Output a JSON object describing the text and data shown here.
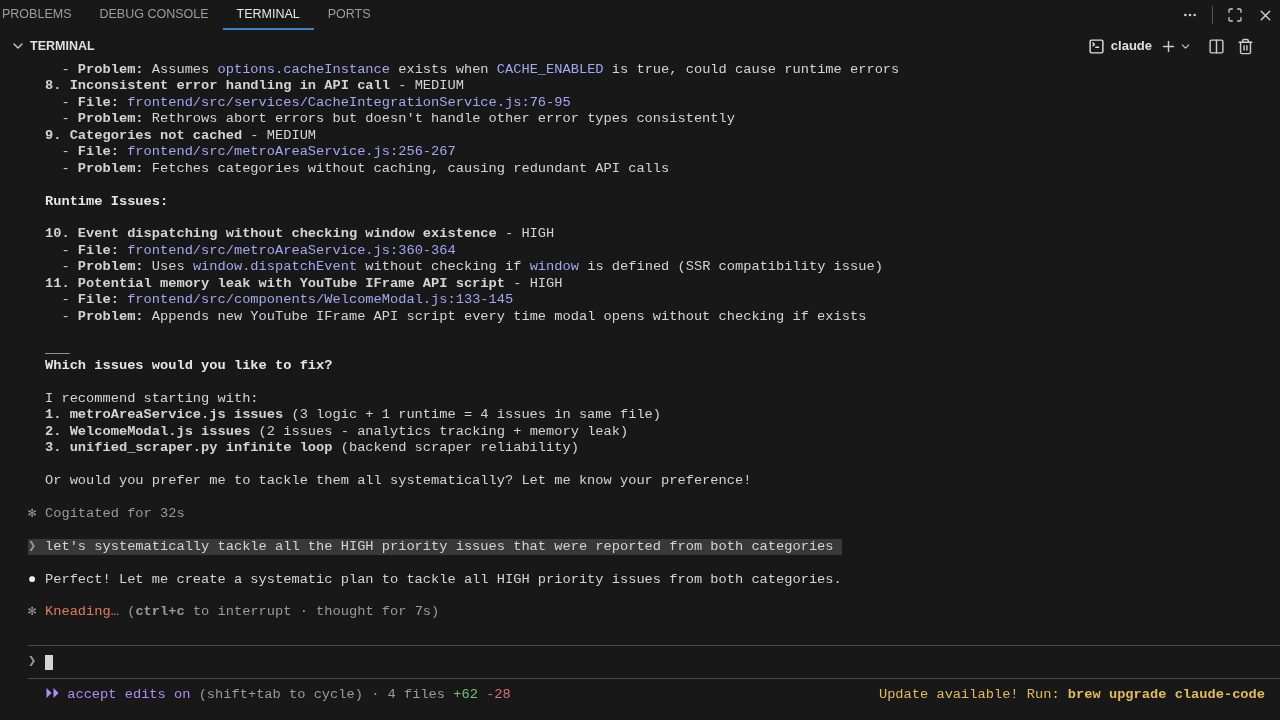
{
  "panel_tabs": [
    {
      "label": "PROBLEMS",
      "selected": false
    },
    {
      "label": "DEBUG CONSOLE",
      "selected": false
    },
    {
      "label": "TERMINAL",
      "selected": true
    },
    {
      "label": "PORTS",
      "selected": false
    }
  ],
  "section": {
    "title": "TERMINAL",
    "expanded": true,
    "shell_name": "claude"
  },
  "lines": [
    {
      "kind": "text",
      "segments": [
        {
          "kind": "text",
          "text": "  - **Problem:** Assumes "
        },
        {
          "kind": "code",
          "text": "options.cacheInstance"
        },
        {
          "kind": "text",
          "text": " exists when "
        },
        {
          "kind": "code",
          "text": "CACHE_ENABLED"
        },
        {
          "kind": "text",
          "text": " is true, could cause runtime errors"
        }
      ]
    },
    {
      "kind": "text",
      "segments": [
        {
          "kind": "text",
          "text": "**8. Inconsistent error handling in API call** - MEDIUM"
        }
      ]
    },
    {
      "kind": "text",
      "segments": [
        {
          "kind": "text",
          "text": "  - **File:** "
        },
        {
          "kind": "code",
          "text": "frontend/src/services/CacheIntegrationService.js:76-95"
        }
      ]
    },
    {
      "kind": "text",
      "segments": [
        {
          "kind": "text",
          "text": "  - **Problem:** Rethrows abort errors but doesn't handle other error types consistently"
        }
      ]
    },
    {
      "kind": "text",
      "segments": [
        {
          "kind": "text",
          "text": "**9. Categories not cached** - MEDIUM"
        }
      ]
    },
    {
      "kind": "text",
      "segments": [
        {
          "kind": "text",
          "text": "  - **File:** "
        },
        {
          "kind": "code",
          "text": "frontend/src/metroAreaService.js:256-267"
        }
      ]
    },
    {
      "kind": "text",
      "segments": [
        {
          "kind": "text",
          "text": "  - **Problem:** Fetches categories without caching, causing redundant API calls"
        }
      ]
    },
    {
      "kind": "blank"
    },
    {
      "kind": "text",
      "segments": [
        {
          "kind": "heading",
          "text": "Runtime Issues:"
        }
      ]
    },
    {
      "kind": "blank"
    },
    {
      "kind": "text",
      "segments": [
        {
          "kind": "text",
          "text": "**10. Event dispatching without checking window existence** - HIGH"
        }
      ]
    },
    {
      "kind": "text",
      "segments": [
        {
          "kind": "text",
          "text": "  - **File:** "
        },
        {
          "kind": "code",
          "text": "frontend/src/metroAreaService.js:360-364"
        }
      ]
    },
    {
      "kind": "text",
      "segments": [
        {
          "kind": "text",
          "text": "  - **Problem:** Uses "
        },
        {
          "kind": "code",
          "text": "window.dispatchEvent"
        },
        {
          "kind": "text",
          "text": " without checking if "
        },
        {
          "kind": "code",
          "text": "window"
        },
        {
          "kind": "text",
          "text": " is defined (SSR compatibility issue)"
        }
      ]
    },
    {
      "kind": "text",
      "segments": [
        {
          "kind": "text",
          "text": "**11. Potential memory leak with YouTube IFrame API script** - HIGH"
        }
      ]
    },
    {
      "kind": "text",
      "segments": [
        {
          "kind": "text",
          "text": "  - **File:** "
        },
        {
          "kind": "code",
          "text": "frontend/src/components/WelcomeModal.js:133-145"
        }
      ]
    },
    {
      "kind": "text",
      "segments": [
        {
          "kind": "text",
          "text": "  - **Problem:** Appends new YouTube IFrame API script every time modal opens without checking if exists"
        }
      ]
    },
    {
      "kind": "blank"
    },
    {
      "kind": "text",
      "segments": [
        {
          "kind": "text",
          "text": "___"
        }
      ]
    },
    {
      "kind": "text",
      "segments": [
        {
          "kind": "heading",
          "text": "Which issues would you like to fix?"
        }
      ]
    },
    {
      "kind": "blank"
    },
    {
      "kind": "text",
      "segments": [
        {
          "kind": "text",
          "text": "I recommend starting with:"
        }
      ]
    },
    {
      "kind": "text",
      "segments": [
        {
          "kind": "text",
          "text": "**1. metroAreaService.js issues** (3 logic + 1 runtime = 4 issues in same file)"
        }
      ]
    },
    {
      "kind": "text",
      "segments": [
        {
          "kind": "text",
          "text": "**2. WelcomeModal.js issues** (2 issues - analytics tracking + memory leak)"
        }
      ]
    },
    {
      "kind": "text",
      "segments": [
        {
          "kind": "text",
          "text": "**3. unified_scraper.py infinite loop** (backend scraper reliability)"
        }
      ]
    },
    {
      "kind": "blank"
    },
    {
      "kind": "text",
      "segments": [
        {
          "kind": "text",
          "text": "Or would you prefer me to tackle them all systematically? Let me know your preference!"
        }
      ]
    },
    {
      "kind": "blank"
    },
    {
      "kind": "status",
      "marker": "✻",
      "segments": [
        {
          "kind": "dim",
          "text": "Cogitated for 32s"
        }
      ]
    },
    {
      "kind": "blank"
    },
    {
      "kind": "prompt",
      "marker": "❯",
      "segments": [
        {
          "kind": "text",
          "text": "let's systematically tackle all the HIGH priority issues that were reported from both categories "
        }
      ]
    },
    {
      "kind": "blank"
    },
    {
      "kind": "bullet",
      "marker": "●",
      "segments": [
        {
          "kind": "text",
          "text": "Perfect! Let me create a systematic plan to tackle all HIGH priority issues from both categories."
        }
      ]
    },
    {
      "kind": "blank"
    },
    {
      "kind": "status",
      "marker": "✻",
      "segments": [
        {
          "kind": "accent",
          "text": "Kneading…"
        },
        {
          "kind": "dim",
          "text": " (**ctrl+c** to interrupt · thought for 7s)"
        }
      ]
    },
    {
      "kind": "blank"
    }
  ],
  "input": {
    "marker": "❯"
  },
  "footer": {
    "left": [
      {
        "kind": "mode",
        "text": "⏵⏵ accept edits on"
      },
      {
        "kind": "dim",
        "text": " (shift+tab to cycle) · 4 files "
      },
      {
        "kind": "added",
        "text": "+62"
      },
      {
        "kind": "removed",
        "text": " -28"
      }
    ],
    "right": [
      {
        "kind": "notice",
        "text": "Update available! Run: **brew upgrade claude-code**"
      }
    ]
  }
}
